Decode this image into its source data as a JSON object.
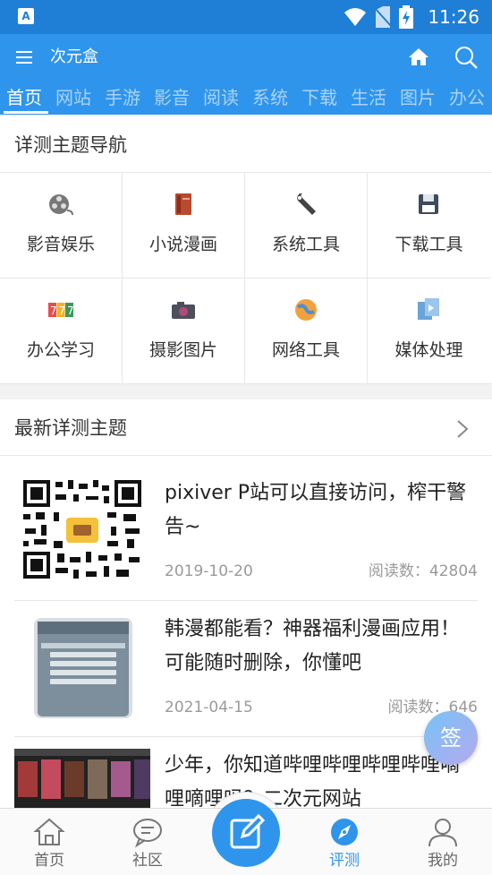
{
  "status_bar": {
    "time": "11:26"
  },
  "app_bar": {
    "title": "次元盒"
  },
  "tabs": [
    "首页",
    "网站",
    "手游",
    "影音",
    "阅读",
    "系统",
    "下载",
    "生活",
    "图片",
    "办公"
  ],
  "nav_section": {
    "title": "详测主题导航",
    "items": [
      {
        "label": "影音娱乐",
        "icon": "film-reel-icon"
      },
      {
        "label": "小说漫画",
        "icon": "book-icon"
      },
      {
        "label": "系统工具",
        "icon": "wrench-icon"
      },
      {
        "label": "下载工具",
        "icon": "floppy-disk-icon"
      },
      {
        "label": "办公学习",
        "icon": "slot-777-icon"
      },
      {
        "label": "摄影图片",
        "icon": "camera-icon"
      },
      {
        "label": "网络工具",
        "icon": "globe-icon"
      },
      {
        "label": "媒体处理",
        "icon": "media-file-icon"
      }
    ]
  },
  "latest": {
    "title": "最新详测主题",
    "articles": [
      {
        "title": "pixiver P站可以直接访问，榨干警告~",
        "date": "2019-10-20",
        "reads": "阅读数：42804"
      },
      {
        "title": "韩漫都能看？神器福利漫画应用！可能随时删除，你懂吧",
        "date": "2021-04-15",
        "reads": "阅读数：646"
      },
      {
        "title": "少年，你知道哔哩哔哩哔哩哔哩嘀哩嘀哩吗？二次元网站",
        "date": "",
        "reads": ""
      }
    ]
  },
  "sign_button": "签",
  "bottom_nav": [
    {
      "label": "首页",
      "icon": "home-outline-icon"
    },
    {
      "label": "社区",
      "icon": "chat-bubble-icon"
    },
    {
      "label": "评测",
      "icon": "compass-icon"
    },
    {
      "label": "我的",
      "icon": "person-icon"
    }
  ],
  "colors": {
    "primary": "#2f95ec",
    "status_bar": "#1f7fd6",
    "tab_inactive": "#a9d3f8"
  }
}
